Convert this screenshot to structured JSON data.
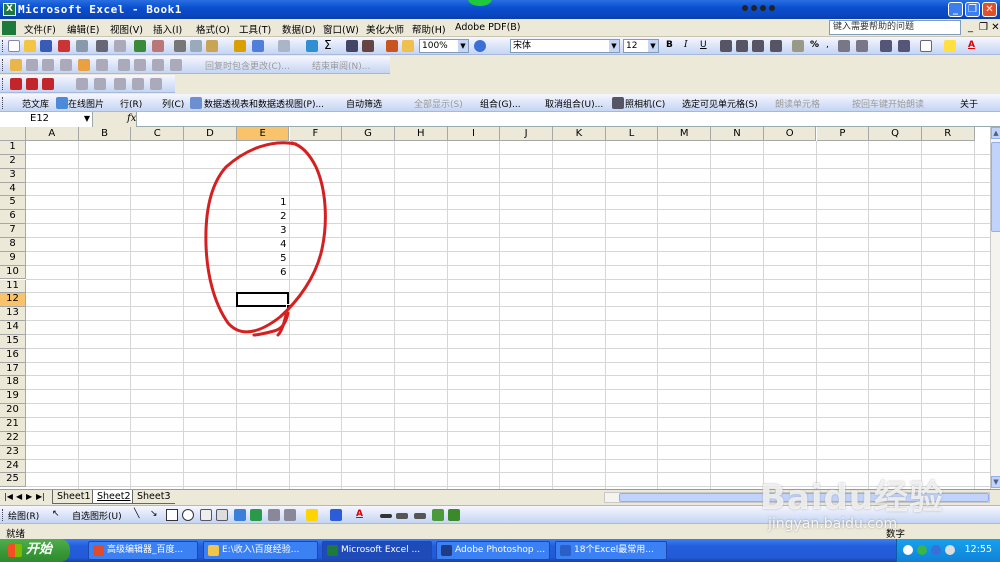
{
  "window": {
    "title": "Microsoft Excel - Book1"
  },
  "menu": {
    "items": [
      "文件(F)",
      "编辑(E)",
      "视图(V)",
      "插入(I)",
      "格式(O)",
      "工具(T)",
      "数据(D)",
      "窗口(W)",
      "美化大师",
      "帮助(H)",
      "Adobe PDF(B)"
    ],
    "help_placeholder": "键入需要帮助的问题"
  },
  "toolbar_standard": {
    "zoom": "100%",
    "font_name": "宋体",
    "font_size": "12"
  },
  "toolbar_review": {
    "reply_changes": "回复时包含更改(C)...",
    "end_review": "结束审阅(N)..."
  },
  "toolbar_extra": {
    "items": [
      "范文库",
      "在线图片",
      "行(R)",
      "列(C)",
      "数据透视表和数据透视图(P)...",
      "自动筛选",
      "全部显示(S)",
      "组合(G)...",
      "取消组合(U)...",
      "照相机(C)",
      "选定可见单元格(S)",
      "朗读单元格",
      "按回车键开始朗读",
      "关于"
    ]
  },
  "formula_bar": {
    "name_box": "E12",
    "fx": "fx",
    "content": ""
  },
  "grid": {
    "columns": [
      "A",
      "B",
      "C",
      "D",
      "E",
      "F",
      "G",
      "H",
      "I",
      "J",
      "K",
      "L",
      "M",
      "N",
      "O",
      "P",
      "Q",
      "R"
    ],
    "rows": [
      "1",
      "2",
      "3",
      "4",
      "5",
      "6",
      "7",
      "8",
      "9",
      "10",
      "11",
      "12",
      "13",
      "14",
      "15",
      "16",
      "17",
      "18",
      "19",
      "20",
      "21",
      "22",
      "23",
      "24",
      "25"
    ],
    "active_column": "E",
    "active_row": "12",
    "cells": [
      {
        "ref": "E5",
        "value": "1"
      },
      {
        "ref": "E6",
        "value": "2"
      },
      {
        "ref": "E7",
        "value": "3"
      },
      {
        "ref": "E8",
        "value": "4"
      },
      {
        "ref": "E9",
        "value": "5"
      },
      {
        "ref": "E10",
        "value": "6"
      }
    ],
    "annotation_color": "#d42020"
  },
  "sheets": {
    "tabs": [
      "Sheet1",
      "Sheet2",
      "Sheet3"
    ],
    "active": "Sheet2"
  },
  "drawing_toolbar": {
    "draw": "绘图(R)",
    "autoshapes": "自选图形(U)"
  },
  "status": {
    "left": "就绪",
    "right": "数字"
  },
  "taskbar": {
    "start": "开始",
    "tasks": [
      "高级编辑器_百度...",
      "E:\\收入\\百度经验...",
      "Microsoft Excel ...",
      "Adobe Photoshop ...",
      "18个Excel最常用..."
    ],
    "active_task_index": 2,
    "clock": "12:55"
  },
  "watermark": {
    "brand": "Baidu经验",
    "site": "jingyan.baidu.com"
  }
}
